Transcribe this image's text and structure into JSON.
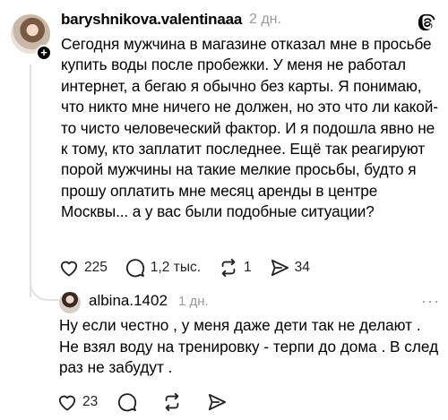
{
  "post": {
    "username": "baryshnikova.valentinaaa",
    "time": "2 дн.",
    "text": "Сегодня мужчина в магазине отказал мне в просьбе купить воды после пробежки. У меня не работал интернет, а бегаю я обычно без карты. Я понимаю, что никто мне ничего не должен, но это что ли какой-то чисто человеческий фактор. И я подошла явно не к тому, кто заплатит последнее. Ещё так реагируют порой мужчины на такие мелкие просьбы, будто я прошу оплатить мне месяц аренды в центре Москвы... а у вас были подобные ситуации?",
    "likes": "225",
    "comments": "1,2 тыс.",
    "reposts": "1",
    "shares": "34"
  },
  "reply": {
    "username": "albina.1402",
    "time": "1 дн.",
    "text": "Ну если честно , у меня даже дети так не делают . Не взял воду на тренировку - терпи до дома . В след раз не забудут .",
    "likes": "23"
  },
  "icons": {
    "like": "heart-icon",
    "comment": "comment-bubble-icon",
    "repost": "repost-icon",
    "share": "send-icon",
    "brand": "threads-logo-icon",
    "more": "more-icon"
  }
}
